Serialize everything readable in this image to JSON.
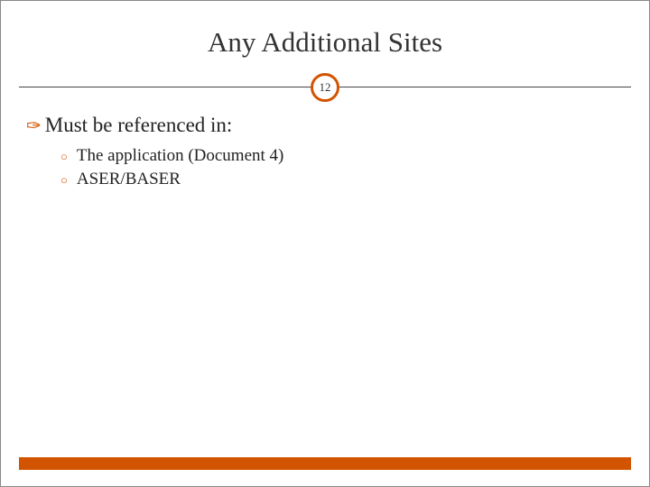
{
  "slide": {
    "title": "Any Additional Sites",
    "page_number": "12",
    "main_bullet": "Must be referenced in:",
    "sub_bullets": [
      "The application (Document 4)",
      "ASER/BASER"
    ]
  }
}
